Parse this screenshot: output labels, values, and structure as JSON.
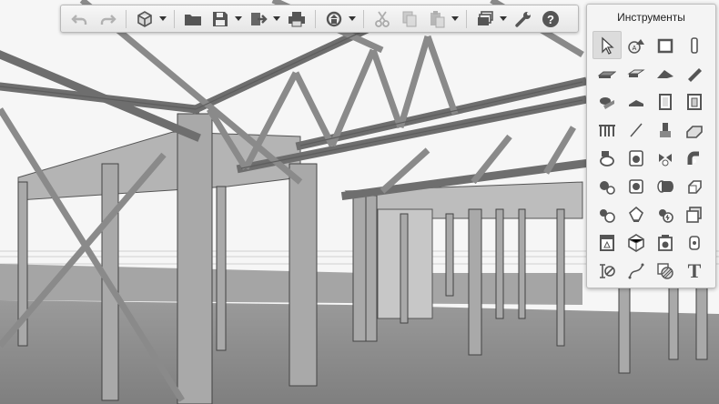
{
  "toolbar": {
    "buttons": [
      {
        "icon": "undo-icon",
        "enabled": false
      },
      {
        "icon": "redo-icon",
        "enabled": false
      },
      {
        "icon": "view-cube-icon",
        "dropdown": true
      },
      {
        "icon": "open-folder-icon"
      },
      {
        "icon": "save-icon",
        "dropdown": true
      },
      {
        "icon": "export-icon",
        "dropdown": true
      },
      {
        "icon": "print-icon"
      },
      {
        "icon": "sync-icon",
        "dropdown": true
      },
      {
        "icon": "cut-icon"
      },
      {
        "icon": "copy-icon"
      },
      {
        "icon": "paste-icon",
        "dropdown": true
      },
      {
        "icon": "layers-icon",
        "dropdown": true
      },
      {
        "icon": "settings-wrench-icon"
      },
      {
        "icon": "help-icon"
      }
    ]
  },
  "tools_panel": {
    "title": "Инструменты",
    "text_tool_glyph": "T",
    "tools": [
      "pointer-arrow-icon",
      "shapes-icon",
      "window-icon",
      "column-icon",
      "slab-icon",
      "roof-slab-icon",
      "roof-icon",
      "beam-icon",
      "curtain-wall-icon",
      "stair-icon",
      "door-icon",
      "frame-door-icon",
      "railing-icon",
      "line-icon",
      "chair-icon",
      "fitting-icon",
      "toilet-icon",
      "washer-icon",
      "valve-icon",
      "pipe-icon",
      "pump-icon",
      "fan-icon",
      "duct-icon",
      "duct-elbow-icon",
      "sprinkler-icon",
      "lamp-icon",
      "electric-icon",
      "panel-icon",
      "cabinet-icon",
      "polyhedron-icon",
      "camera-box-icon",
      "device-icon",
      "dimension-icon",
      "curve-icon",
      "hatch-icon",
      "text-icon"
    ]
  },
  "colors": {
    "sky": "#f6f6f6",
    "floor": "#8c8c8c",
    "steel": "#9c9c9c",
    "icon": "#555555",
    "accent_panel": "#f4f4f4"
  }
}
